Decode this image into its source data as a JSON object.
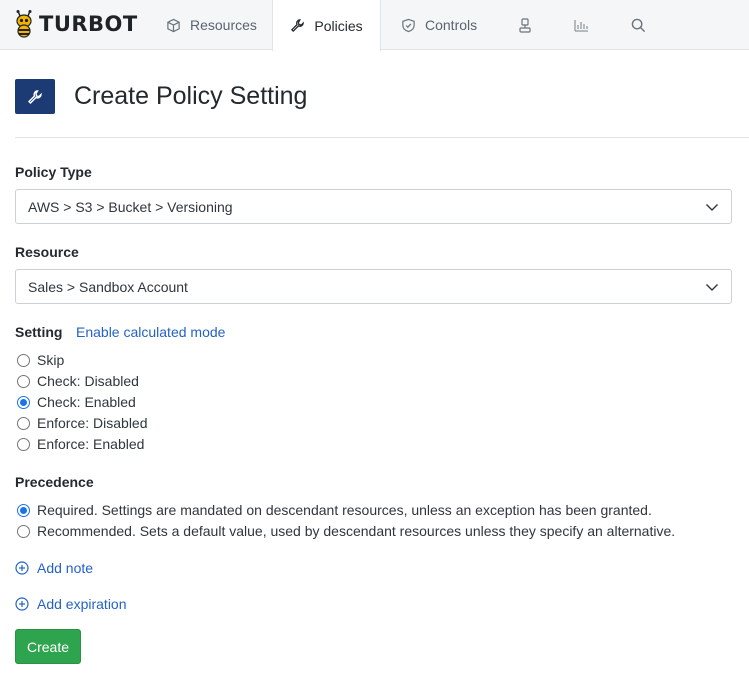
{
  "brand": {
    "logo_text": "TURBOT"
  },
  "nav": {
    "tabs": [
      {
        "label": "Resources",
        "icon": "cube-icon"
      },
      {
        "label": "Policies",
        "icon": "wrench-icon",
        "active": true
      },
      {
        "label": "Controls",
        "icon": "shield-check-icon"
      }
    ],
    "icons": [
      "user-icon",
      "chart-icon",
      "search-icon"
    ]
  },
  "page": {
    "title": "Create Policy Setting",
    "icon": "wrench-icon",
    "icon_bg": "#1c3b75"
  },
  "policy_type": {
    "label": "Policy Type",
    "value": "AWS > S3 > Bucket > Versioning"
  },
  "resource": {
    "label": "Resource",
    "value": "Sales > Sandbox Account"
  },
  "setting": {
    "label": "Setting",
    "calc_link": "Enable calculated mode",
    "options": [
      "Skip",
      "Check: Disabled",
      "Check: Enabled",
      "Enforce: Disabled",
      "Enforce: Enabled"
    ],
    "selected": "Check: Enabled"
  },
  "precedence": {
    "label": "Precedence",
    "options": [
      "Required. Settings are mandated on descendant resources, unless an exception has been granted.",
      "Recommended. Sets a default value, used by descendant resources unless they specify an alternative."
    ],
    "selected": "Required. Settings are mandated on descendant resources, unless an exception has been granted."
  },
  "actions": {
    "add_note": "Add note",
    "add_expiration": "Add expiration",
    "create": "Create"
  },
  "colors": {
    "accent": "#2562c4",
    "create_button": "#2ea44f",
    "radio_selected": "#1a73e8"
  }
}
